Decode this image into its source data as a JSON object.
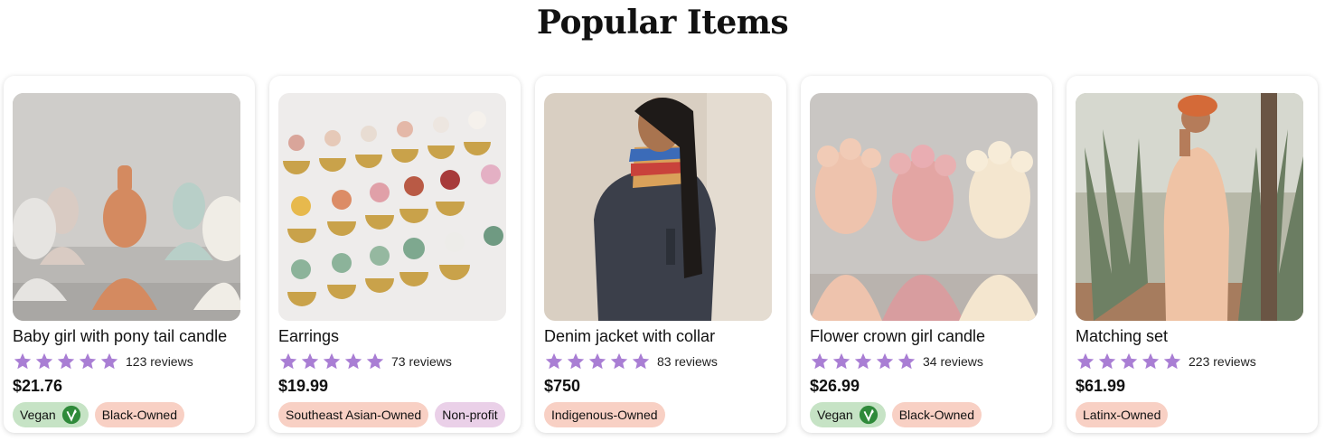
{
  "page": {
    "title": "Popular Items"
  },
  "colors": {
    "star": "#a97ed4",
    "vegan_tag": "#c6e3c5",
    "owner_tag": "#f8d0c4",
    "nonprofit_tag": "#ead0e8",
    "leaf": "#2f8a3a"
  },
  "icons": {
    "star": "star-icon",
    "vegan": "leaf-icon"
  },
  "products": [
    {
      "name": "Baby girl with pony tail candle",
      "rating": 5,
      "reviews": "123 reviews",
      "price": "$21.76",
      "tags": [
        "Vegan",
        "Black-Owned"
      ]
    },
    {
      "name": "Earrings",
      "rating": 5,
      "reviews": "73 reviews",
      "price": "$19.99",
      "tags": [
        "Southeast Asian-Owned",
        "Non-profit"
      ]
    },
    {
      "name": "Denim jacket with collar",
      "rating": 5,
      "reviews": "83 reviews",
      "price": "$750",
      "tags": [
        "Indigenous-Owned"
      ]
    },
    {
      "name": "Flower crown girl candle",
      "rating": 5,
      "reviews": "34 reviews",
      "price": "$26.99",
      "tags": [
        "Vegan",
        "Black-Owned"
      ]
    },
    {
      "name": "Matching set",
      "rating": 5,
      "reviews": "223 reviews",
      "price": "$61.99",
      "tags": [
        "Latinx-Owned"
      ]
    }
  ]
}
